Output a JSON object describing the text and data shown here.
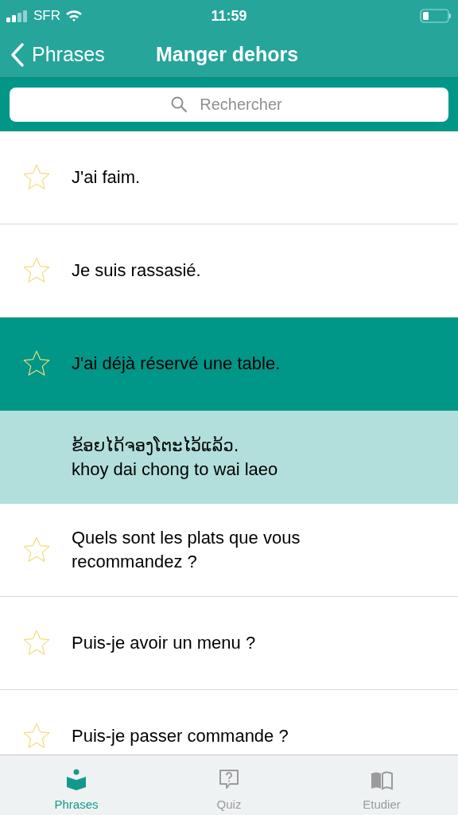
{
  "status_bar": {
    "carrier": "SFR",
    "time": "11:59"
  },
  "nav": {
    "back_label": "Phrases",
    "title": "Manger dehors"
  },
  "search": {
    "placeholder": "Rechercher"
  },
  "phrases": [
    {
      "text": "J'ai faim.",
      "starred": false,
      "selected": false
    },
    {
      "text": "Je suis rassasié.",
      "starred": false,
      "selected": false
    },
    {
      "text": "J'ai déjà réservé une table.",
      "starred": false,
      "selected": true,
      "translation": {
        "native": "ຂ້ອຍໄດ້ຈອງໂຕະໄວ້ແລ້ວ.",
        "romanization": "khoy dai chong to wai laeo"
      }
    },
    {
      "text": "Quels sont les plats que vous recommandez ?",
      "starred": false,
      "selected": false
    },
    {
      "text": "Puis-je avoir un menu ?",
      "starred": false,
      "selected": false
    },
    {
      "text": "Puis-je passer commande ?",
      "starred": false,
      "selected": false
    }
  ],
  "tabs": [
    {
      "kind": "reader",
      "label": "Phrases",
      "selected": true
    },
    {
      "kind": "quiz",
      "label": "Quiz",
      "selected": false
    },
    {
      "kind": "book",
      "label": "Etudier",
      "selected": false
    }
  ]
}
